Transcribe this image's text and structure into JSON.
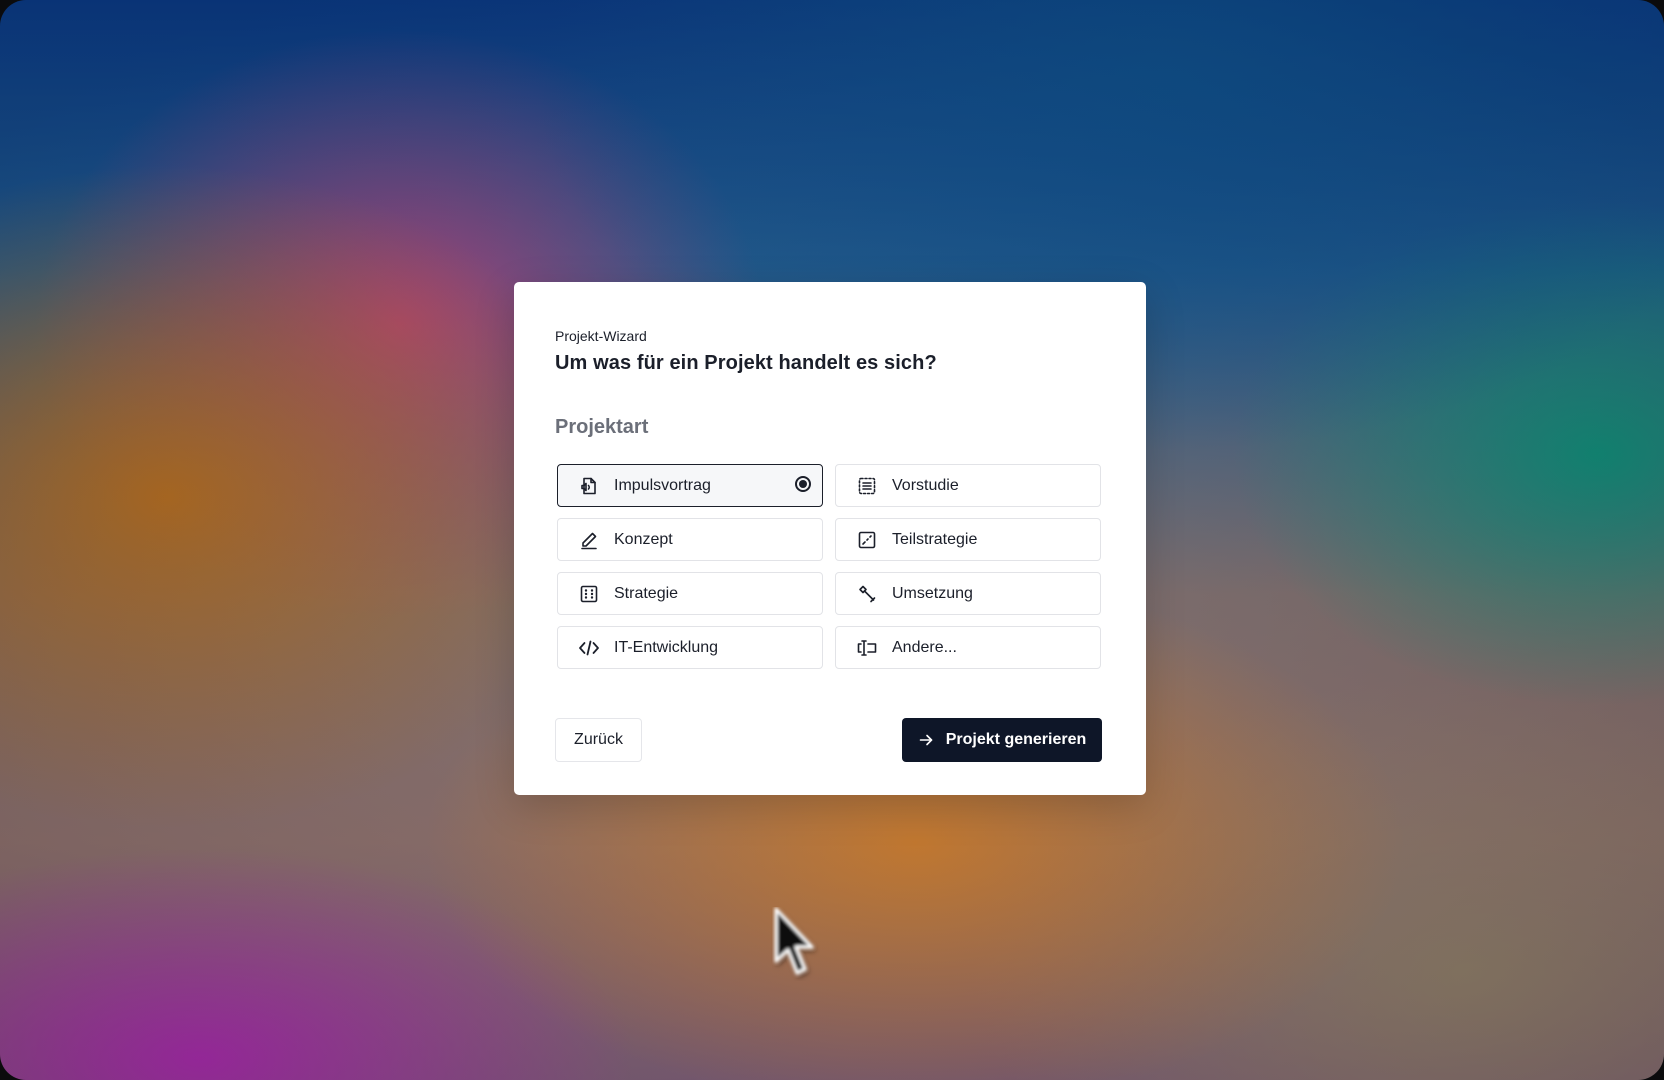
{
  "wizard": {
    "eyebrow": "Projekt-Wizard",
    "title": "Um was für ein Projekt handelt es sich?",
    "section_label": "Projektart",
    "options": [
      {
        "label": "Impulsvortrag",
        "icon": "file-audio-icon",
        "selected": true
      },
      {
        "label": "Vorstudie",
        "icon": "list-dashed-icon",
        "selected": false
      },
      {
        "label": "Konzept",
        "icon": "pen-icon",
        "selected": false
      },
      {
        "label": "Teilstrategie",
        "icon": "chart-square-icon",
        "selected": false
      },
      {
        "label": "Strategie",
        "icon": "grid-square-icon",
        "selected": false
      },
      {
        "label": "Umsetzung",
        "icon": "hammer-icon",
        "selected": false
      },
      {
        "label": "IT-Entwicklung",
        "icon": "code-icon",
        "selected": false
      },
      {
        "label": "Andere...",
        "icon": "text-cursor-icon",
        "selected": false
      }
    ],
    "back_label": "Zurück",
    "submit_label": "Projekt generieren"
  },
  "colors": {
    "primary": "#0e1628",
    "text": "#1b1f2a",
    "muted": "#6b6f79",
    "border": "#e2e3e7"
  }
}
